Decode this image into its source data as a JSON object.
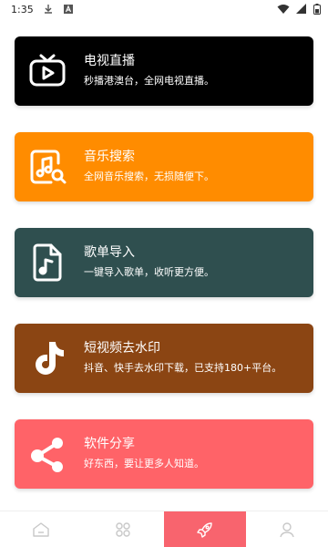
{
  "status_bar": {
    "time": "1:35",
    "icons": [
      "download-icon",
      "a-notification-icon",
      "wifi-icon",
      "signal-icon",
      "battery-icon"
    ]
  },
  "cards": [
    {
      "title": "电视直播",
      "subtitle": "秒播港澳台，全网电视直播。",
      "icon": "tv-icon",
      "color": "#000000"
    },
    {
      "title": "音乐搜索",
      "subtitle": "全网音乐搜索，无损随便下。",
      "icon": "music-search-icon",
      "color": "#ff8c00"
    },
    {
      "title": "歌单导入",
      "subtitle": "一键导入歌单，收听更方便。",
      "icon": "playlist-file-icon",
      "color": "#2f4f4f"
    },
    {
      "title": "短视频去水印",
      "subtitle": "抖音、快手去水印下载，已支持180+平台。",
      "icon": "tiktok-icon",
      "color": "#8b4513"
    },
    {
      "title": "软件分享",
      "subtitle": "好东西，要让更多人知道。",
      "icon": "share-icon",
      "color": "#ff6368"
    }
  ],
  "bottom_nav": {
    "items": [
      "home-icon",
      "apps-icon",
      "rocket-icon",
      "profile-icon"
    ],
    "active_index": 2,
    "active_color": "#f8646e",
    "icon_color": "#c8c8c8"
  }
}
